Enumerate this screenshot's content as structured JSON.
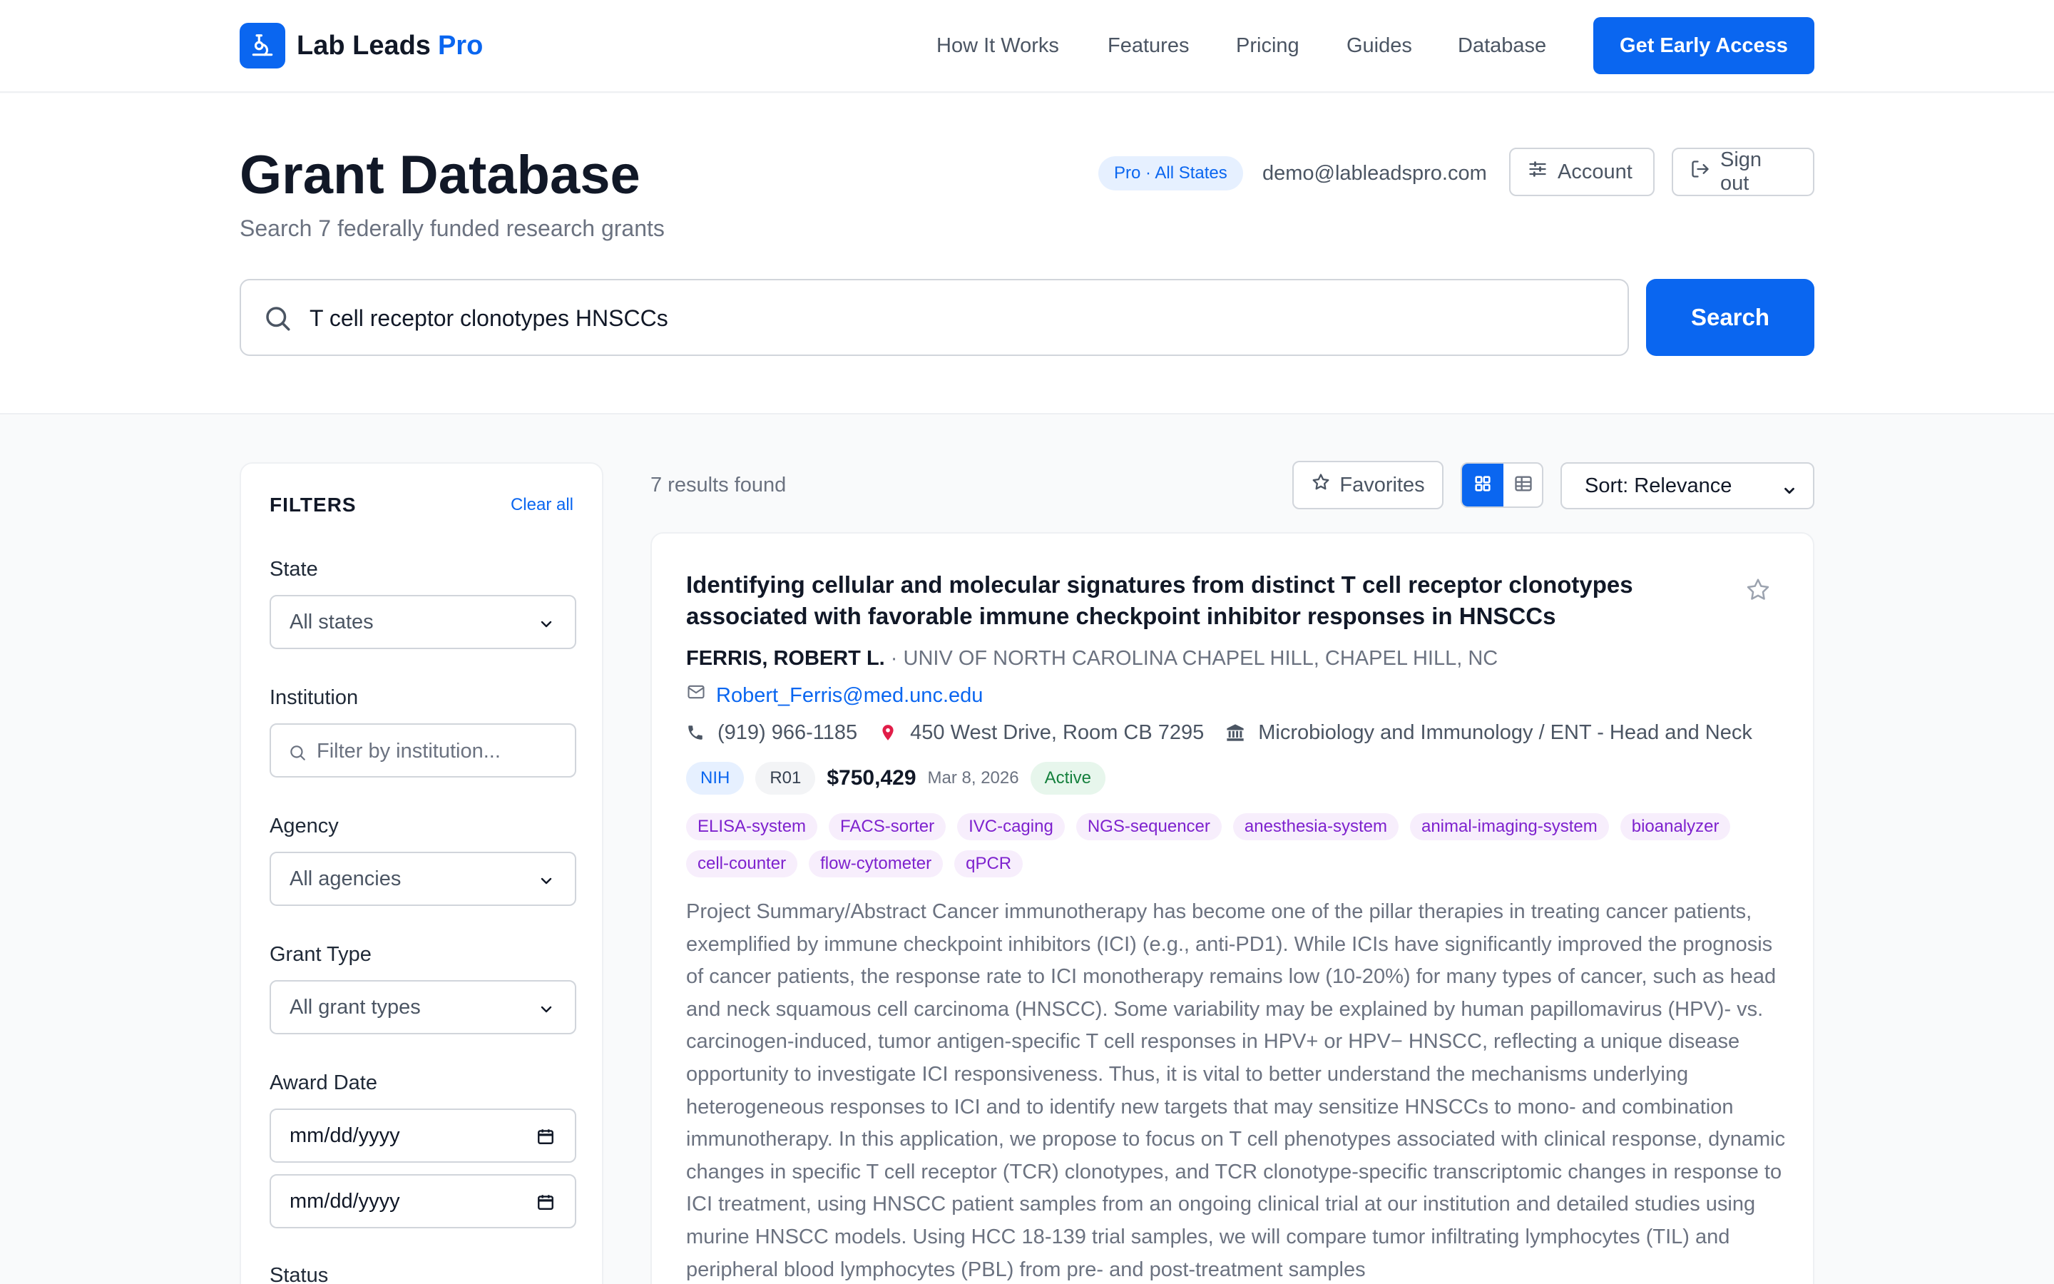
{
  "nav": {
    "brand": "Lab Leads",
    "brand_accent": "Pro",
    "links": [
      "How It Works",
      "Features",
      "Pricing",
      "Guides",
      "Database"
    ],
    "cta": "Get Early Access"
  },
  "header": {
    "title": "Grant Database",
    "subtitle": "Search 7 federally funded research grants",
    "plan_badge": "Pro · All States",
    "email": "demo@lableadspro.com",
    "account_label": "Account",
    "signout_label": "Sign out"
  },
  "search": {
    "query": "T cell receptor clonotypes HNSCCs",
    "button": "Search"
  },
  "filters": {
    "title": "FILTERS",
    "clear": "Clear all",
    "state_label": "State",
    "state_value": "All states",
    "institution_label": "Institution",
    "institution_placeholder": "Filter by institution...",
    "agency_label": "Agency",
    "agency_value": "All agencies",
    "type_label": "Grant Type",
    "type_value": "All grant types",
    "date_label": "Award Date",
    "date_from": "mm/dd/yyyy",
    "date_to": "mm/dd/yyyy",
    "status_label": "Status"
  },
  "results": {
    "count_text": "7 results found",
    "favorites": "Favorites",
    "sort": "Sort: Relevance"
  },
  "grant": {
    "title": "Identifying cellular and molecular signatures from distinct T cell receptor clonotypes associated with favorable immune checkpoint inhibitor responses in HNSCCs",
    "pi": "FERRIS, ROBERT L.",
    "institution": "· UNIV OF NORTH CAROLINA CHAPEL HILL, CHAPEL HILL, NC",
    "email": "Robert_Ferris@med.unc.edu",
    "phone": "(919) 966-1185",
    "address": "450 West Drive, Room CB 7295",
    "department": "Microbiology and Immunology / ENT - Head and Neck",
    "agency": "NIH",
    "type": "R01",
    "amount": "$750,429",
    "date": "Mar 8, 2026",
    "status": "Active",
    "tags": [
      "ELISA-system",
      "FACS-sorter",
      "IVC-caging",
      "NGS-sequencer",
      "anesthesia-system",
      "animal-imaging-system",
      "bioanalyzer",
      "cell-counter",
      "flow-cytometer",
      "qPCR"
    ],
    "abstract": "Project Summary/Abstract Cancer immunotherapy has become one of the pillar therapies in treating cancer patients, exemplified by immune checkpoint inhibitors (ICI) (e.g., anti-PD1). While ICIs have significantly improved the prognosis of cancer patients, the response rate to ICI monotherapy remains low (10-20%) for many types of cancer, such as head and neck squamous cell carcinoma (HNSCC). Some variability may be explained by human papillomavirus (HPV)- vs. carcinogen-induced, tumor antigen-specific T cell responses in HPV+ or HPV− HNSCC, reflecting a unique disease opportunity to investigate ICI responsiveness. Thus, it is vital to better understand the mechanisms underlying heterogeneous responses to ICI and to identify new targets that may sensitize HNSCCs to mono- and combination immunotherapy. In this application, we propose to focus on T cell phenotypes associated with clinical response, dynamic changes in specific T cell receptor (TCR) clonotypes, and TCR clonotype-specific transcriptomic changes in response to ICI treatment, using HNSCC patient samples from an ongoing clinical trial at our institution and detailed studies using murine HNSCC models. Using HCC 18-139 trial samples, we will compare tumor infiltrating lymphocytes (TIL) and peripheral blood lymphocytes (PBL) from pre- and post-treatment samples"
  },
  "colors": {
    "primary": "#0a66f0",
    "tag_bg": "#f7eefc",
    "tag_text": "#7e22ce",
    "status_green": "#15803d"
  },
  "icons": [
    "logo-icon",
    "search-icon",
    "sliders-icon",
    "sign-out-icon",
    "chevron-down-icon",
    "calendar-icon",
    "star-icon",
    "grid-icon",
    "table-icon",
    "mail-icon",
    "phone-icon",
    "pin-icon",
    "building-icon"
  ]
}
